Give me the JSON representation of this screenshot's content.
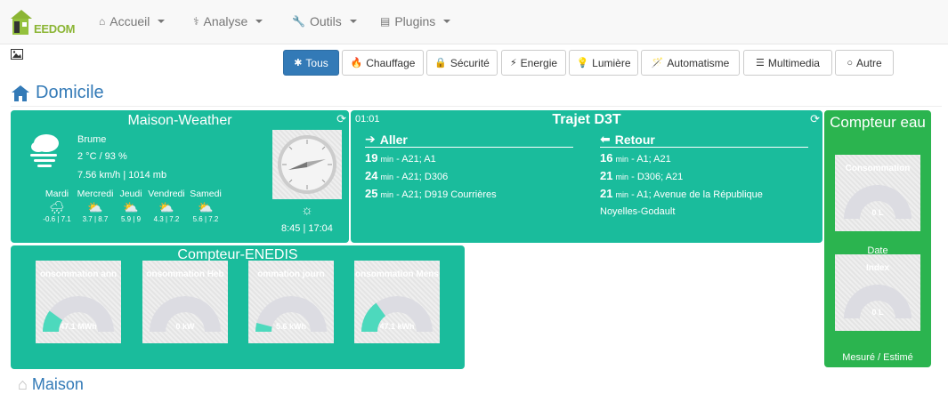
{
  "app": {
    "logo_text": "EEDOM"
  },
  "nav": [
    {
      "label": "Accueil",
      "icon": "home-icon"
    },
    {
      "label": "Analyse",
      "icon": "stethoscope-icon"
    },
    {
      "label": "Outils",
      "icon": "wrench-icon"
    },
    {
      "label": "Plugins",
      "icon": "tasks-icon"
    }
  ],
  "filters": [
    {
      "label": "Tous",
      "icon": "asterisk-icon",
      "active": true
    },
    {
      "label": "Chauffage",
      "icon": "fire-icon"
    },
    {
      "label": "Sécurité",
      "icon": "lock-icon"
    },
    {
      "label": "Energie",
      "icon": "bolt-icon"
    },
    {
      "label": "Lumière",
      "icon": "lightbulb-icon"
    },
    {
      "label": "Automatisme",
      "icon": "magic-icon"
    },
    {
      "label": "Multimedia",
      "icon": "sliders-icon"
    },
    {
      "label": "Autre",
      "icon": "circle-icon"
    }
  ],
  "object": {
    "title": "Domicile",
    "next_title": "Maison"
  },
  "weather": {
    "title": "Maison-Weather",
    "condition": "Brume",
    "temp_humidity": "2 °C / 93 %",
    "wind_pressure": "7.56 km/h | 1014 mb",
    "sun_times": "8:45 | 17:04",
    "forecast": [
      {
        "day": "Mardi",
        "range": "-0.6 | 7.1"
      },
      {
        "day": "Mercredi",
        "range": "3.7 | 8.7"
      },
      {
        "day": "Jeudi",
        "range": "5.9 | 9"
      },
      {
        "day": "Vendredi",
        "range": "4.3 | 7.2"
      },
      {
        "day": "Samedi",
        "range": "5.6 | 7.2"
      }
    ],
    "colors": {
      "widget": "#1abc9c"
    }
  },
  "trajet": {
    "time": "01:01",
    "title": "Trajet D3T",
    "aller": {
      "label": "Aller",
      "routes": [
        {
          "min": "19",
          "unit": "min",
          "route": "- A21; A1"
        },
        {
          "min": "24",
          "unit": "min",
          "route": "- A21; D306"
        },
        {
          "min": "25",
          "unit": "min",
          "route": "- A21; D919 Courrières"
        }
      ]
    },
    "retour": {
      "label": "Retour",
      "routes": [
        {
          "min": "16",
          "unit": "min",
          "route": "- A1; A21"
        },
        {
          "min": "21",
          "unit": "min",
          "route": "- D306; A21"
        },
        {
          "min": "21",
          "unit": "min",
          "route": "- A1; Avenue de la République"
        }
      ],
      "extra": "Noyelles-Godault"
    }
  },
  "eau": {
    "title": "Compteur eau",
    "gauges": [
      {
        "title": "Consommation",
        "value": "0 L",
        "fraction": 0
      },
      {
        "title": "Index",
        "value": "0 L",
        "fraction": 0
      }
    ],
    "date_label": "Date",
    "footer": "Mesuré / Estimé",
    "color": "#2bb44f"
  },
  "enedis": {
    "title": "Compteur-ENEDIS",
    "gauges": [
      {
        "title": "onsommation ann",
        "value": "47.1 MWh",
        "fraction": 0.2
      },
      {
        "title": "onsommation Heb",
        "value": "0 kW",
        "fraction": 0
      },
      {
        "title": "ommation journ",
        "value": "5.6 kWh",
        "fraction": 0.08
      },
      {
        "title": "onsommation Mens",
        "value": "47.1 kWh",
        "fraction": 0.3
      }
    ],
    "gauge_fill": "#4dd9bd"
  }
}
